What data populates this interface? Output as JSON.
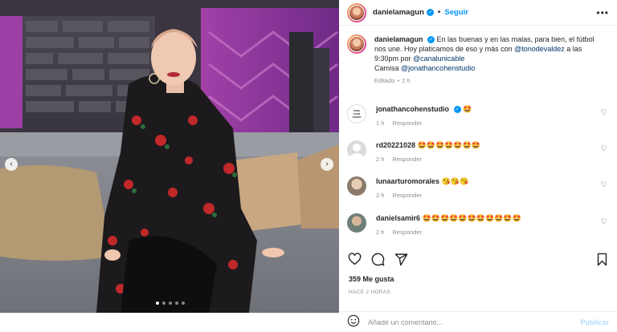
{
  "post": {
    "username": "danielamagun",
    "follow_label": "Seguir",
    "dot_separator": "•",
    "more_label": "•••",
    "caption_user": "danielamagun",
    "caption_text_1": "En las buenas y en las malas, para bien, el fútbol nos une. Hoy platicamos de eso y más con ",
    "caption_mention_1": "@tonodevaldez",
    "caption_text_2": " a las 9:30pm por ",
    "caption_mention_2": "@canalunicable",
    "caption_text_3": "Camisa ",
    "caption_mention_3": "@jonathancohenstudio",
    "caption_edited": "Editado",
    "caption_time": "2 h",
    "likes": "359 Me gusta",
    "time_ago": "HACE 2 HORAS",
    "comment_placeholder": "Añade un comentario...",
    "publish_label": "Publicar",
    "carousel_slides": 5,
    "carousel_active": 1
  },
  "comments": [
    {
      "user": "jonathancohenstudio",
      "verified": true,
      "text": "🤩",
      "time": "1 h",
      "reply": "Responder",
      "avatar_color": "#ffffff"
    },
    {
      "user": "rd20221028",
      "verified": false,
      "text": "🤩🤩🤩🤩🤩🤩🤩",
      "time": "2 h",
      "reply": "Responder",
      "avatar_color": "#dbdbdb"
    },
    {
      "user": "lunaarturomorales",
      "verified": false,
      "text": "😘😘😘",
      "time": "2 h",
      "reply": "Responder",
      "avatar_color": "#c9b49b"
    },
    {
      "user": "danielsamir6",
      "verified": false,
      "text": "🤩🤩🤩🤩🤩🤩🤩🤩🤩🤩🤩",
      "time": "2 h",
      "reply": "Responder",
      "avatar_color": "#9aa6a0"
    }
  ],
  "icons": {
    "nav_prev": "chevron-left-icon",
    "nav_next": "chevron-right-icon",
    "like": "heart-icon",
    "comment": "comment-icon",
    "share": "send-icon",
    "save": "bookmark-icon",
    "emoji": "emoji-icon",
    "verified": "verified-badge-icon"
  },
  "colors": {
    "accent": "#0095f6",
    "link": "#00376b",
    "muted": "#8e8e8e",
    "publish_disabled": "#b2dffc"
  }
}
